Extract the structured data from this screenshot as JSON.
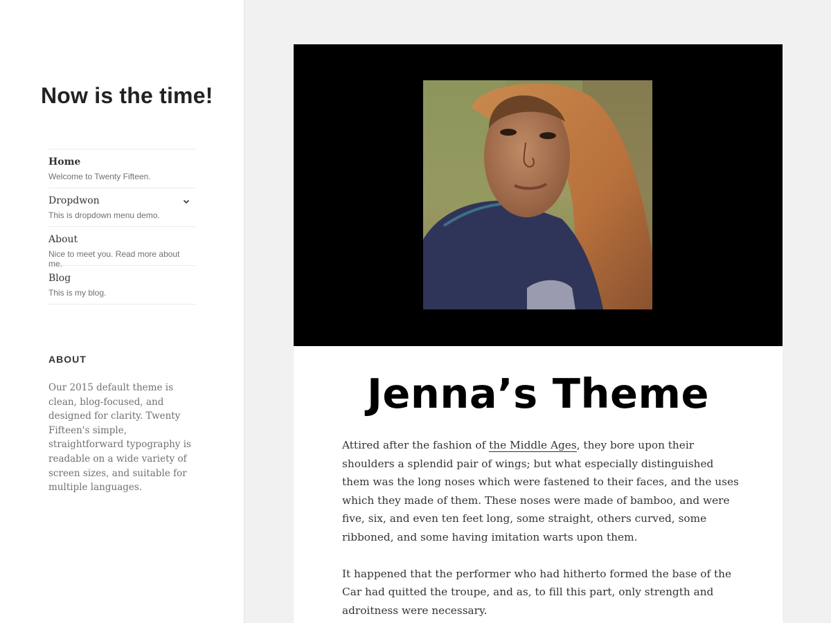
{
  "site": {
    "title": "Now is the time!"
  },
  "menu": {
    "items": [
      {
        "label": "Home",
        "description": "Welcome to Twenty Fifteen.",
        "current": true
      },
      {
        "label": "Dropdwon",
        "description": "This is dropdown menu demo.",
        "has_submenu": true
      },
      {
        "label": "About",
        "description": "Nice to meet you. Read more about me."
      },
      {
        "label": "Blog",
        "description": "This is my blog."
      }
    ]
  },
  "widget": {
    "title": "ABOUT",
    "text": "Our 2015 default theme is clean, blog-focused, and designed for clarity. Twenty Fifteen's simple, straightforward typography is readable on a wide variety of screen sizes, and suitable for multiple languages."
  },
  "post": {
    "title": "Jenna’s Theme",
    "paragraph1": {
      "before": "Attired after the fashion of ",
      "link": "the Middle Ages",
      "after": ", they bore upon their shoulders a splendid pair of wings; but what especially distinguished them was the long noses which were fastened to their faces, and the uses which they made of them. These noses were made of bamboo, and were five, six, and even ten feet long, some straight, others curved, some ribboned, and some having imitation warts upon them."
    },
    "paragraph2": "It happened that the performer who had hitherto formed the base of the Car had quitted the troupe, and as, to fill this part, only strength and adroitness were necessary."
  },
  "colors": {
    "page_background": "#f1f1f1",
    "sidebar_background": "#ffffff",
    "featured_background": "#000000",
    "title_color": "#000000"
  },
  "icons": {
    "dropdown_toggle": "chevron-down-icon"
  }
}
